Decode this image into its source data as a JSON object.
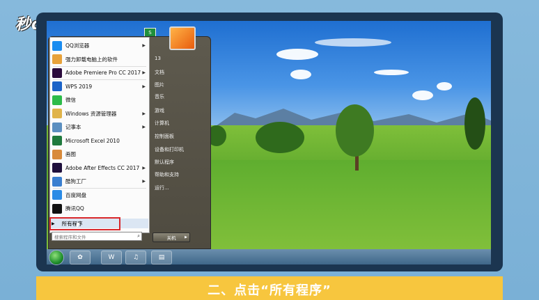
{
  "logo": {
    "text": "秒dong视频"
  },
  "caption": "二、点击“所有程序”",
  "start_menu": {
    "programs": [
      {
        "label": "QQ浏览器",
        "icon": "qq-browser-icon",
        "color": "#1a8cf0",
        "has_arrow": true
      },
      {
        "label": "强力卸载电脑上的软件",
        "icon": "uninstaller-icon",
        "color": "#e8a23a",
        "has_arrow": false
      },
      {
        "label": "Adobe Premiere Pro CC 2017",
        "icon": "premiere-icon",
        "color": "#2a0a3c",
        "has_arrow": true
      },
      {
        "label": "WPS 2019",
        "icon": "wps-icon",
        "color": "#1b63c8",
        "has_arrow": true
      },
      {
        "label": "微信",
        "icon": "wechat-icon",
        "color": "#2dbb49",
        "has_arrow": false
      },
      {
        "label": "Windows 资源管理器",
        "icon": "explorer-icon",
        "color": "#e0b44a",
        "has_arrow": true
      },
      {
        "label": "记事本",
        "icon": "notepad-icon",
        "color": "#5b8fc0",
        "has_arrow": true
      },
      {
        "label": "Microsoft Excel 2010",
        "icon": "excel-icon",
        "color": "#1f7a3d",
        "has_arrow": false
      },
      {
        "label": "画图",
        "icon": "paint-icon",
        "color": "#d88a3a",
        "has_arrow": false
      },
      {
        "label": "Adobe After Effects CC 2017",
        "icon": "after-effects-icon",
        "color": "#1e0f3c",
        "has_arrow": true
      },
      {
        "label": "酷狗工厂",
        "icon": "factory-icon",
        "color": "#3a7fd0",
        "has_arrow": true
      },
      {
        "label": "百度网盘",
        "icon": "baidu-netdisk-icon",
        "color": "#2a8be6",
        "has_arrow": false
      },
      {
        "label": "腾讯QQ",
        "icon": "qq-icon",
        "color": "#111111",
        "has_arrow": false
      }
    ],
    "all_programs": "所有程序",
    "search_placeholder": "搜索程序和文件",
    "right_items": [
      "13",
      "文档",
      "图片",
      "音乐",
      "游戏",
      "计算机",
      "控制面板",
      "设备和打印机",
      "默认程序",
      "帮助和支持",
      "运行..."
    ],
    "shutdown": "关机"
  },
  "accent_color": "#d9262a",
  "caption_bar_color": "#f7c63e"
}
